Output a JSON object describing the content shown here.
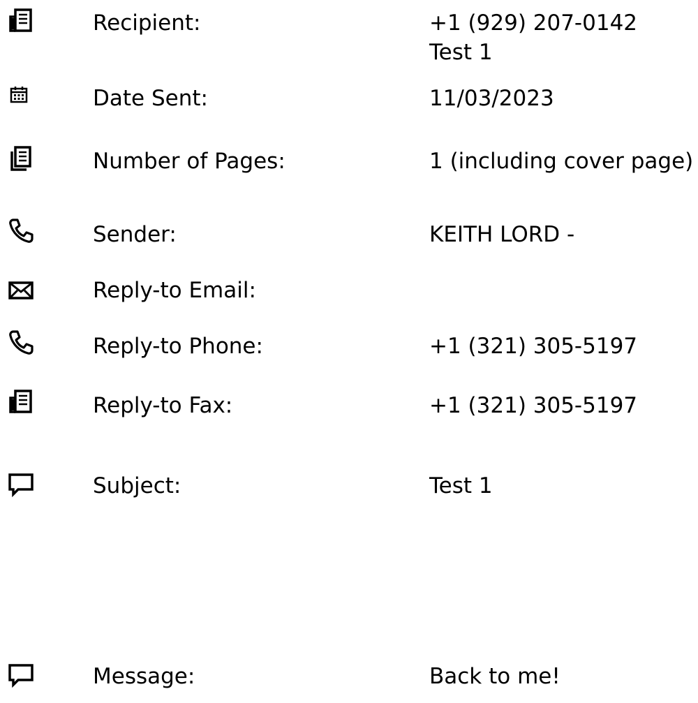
{
  "fields": [
    {
      "icon": "fax-icon",
      "label": "Recipient:",
      "value_lines": [
        "+1 (929) 207-0142",
        "Test 1"
      ]
    },
    {
      "icon": "calendar-icon",
      "label": "Date Sent:",
      "value": "11/03/2023"
    },
    {
      "icon": "pages-icon",
      "label": "Number of Pages:",
      "value": "1 (including cover page)"
    },
    {
      "icon": "phone-icon",
      "label": "Sender:",
      "value": "KEITH LORD -"
    },
    {
      "icon": "envelope-icon",
      "label": "Reply-to Email:",
      "value": ""
    },
    {
      "icon": "phone-icon",
      "label": "Reply-to Phone:",
      "value": "+1 (321) 305-5197"
    },
    {
      "icon": "fax-icon",
      "label": "Reply-to Fax:",
      "value": "+1 (321) 305-5197"
    },
    {
      "icon": "speech-bubble-icon",
      "label": "Subject:",
      "value": "Test 1"
    },
    {
      "icon": "speech-bubble-icon",
      "label": "Message:",
      "value": "Back to me!"
    }
  ]
}
